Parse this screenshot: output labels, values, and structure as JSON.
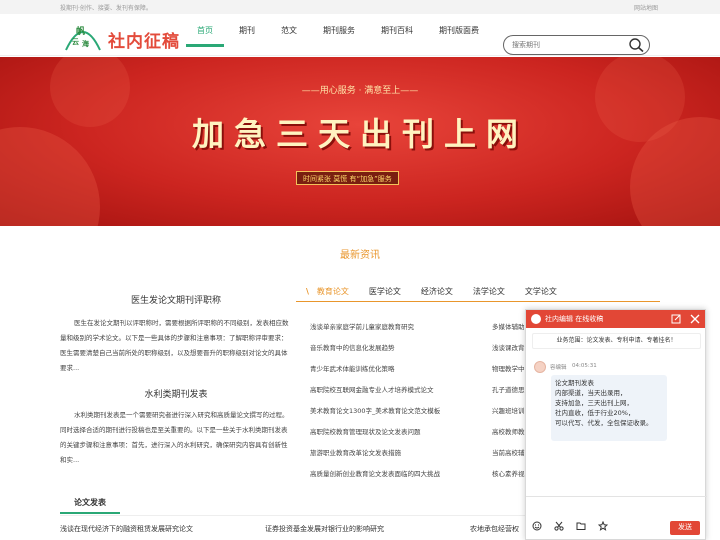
{
  "topbar": {
    "tagline": "投期刊·创作、接要、发刊有保障。",
    "sitemap": "网站地图"
  },
  "header": {
    "logo_text": "帆云海",
    "brand": "社内征稿",
    "nav": [
      "首页",
      "期刊",
      "范文",
      "期刊服务",
      "期刊百科",
      "期刊版面费"
    ],
    "search_placeholder": "搜索期刊"
  },
  "banner": {
    "tagline": "——用心服务 · 满意至上——",
    "title": "加急三天出刊上网",
    "slogan": "时间紧张 莫慌 有“加急”服务"
  },
  "news": {
    "section_title": "最新资讯",
    "article1_title": "医生发论文期刊评职称",
    "article1_text": "医生在发论文期刊以评职称时，需要根据所评职称的不同级别，发表相应数量和级别的学术论文。以下是一些具体的步骤和注意事项：了解职称评审要求：医生需要清楚自己当前所处的职称级别，以及想要晋升的职称级别对论文的具体要求...",
    "article2_title": "水利类期刊发表",
    "article2_text": "水利类期刊发表是一个需要研究者进行深入研究和高质量论文撰写的过程。同时选择合适的期刊进行投稿也是至关重要的。以下是一些关于水利类期刊发表的关键步骤和注意事项：首先，进行深入的水利研究，确保研究内容具有创新性和实...",
    "tabs": [
      "教育论文",
      "医学论文",
      "经济论文",
      "法学论文",
      "文学论文"
    ],
    "list_left": [
      "浅谈单亲家庭学前儿童家庭教育研究",
      "音乐教育中的信息化发展趋势",
      "青少年武术体能训练优化策略",
      "高职院校互联网金融专业人才培养模式论文",
      "美术教育论文1300字_美术教育论文范文模板",
      "高职院校教育管理现状及论文发表问题",
      "旅游职业教育改革论文发表措施",
      "高质量创新创业教育论文发表面临的四大挑战"
    ],
    "list_right": [
      "多媒体辅助",
      "浅谈课改背",
      "物理教学中",
      "孔子道德思",
      "兴趣班培训",
      "高校教师教",
      "当前高校辅",
      "核心素养视"
    ]
  },
  "footer": {
    "section_title": "论文发表",
    "papers": [
      "浅谈在现代经济下的融资租赁发展研究论文",
      "证券投资基金发展对银行业的影响研究",
      "农地承包经营权"
    ]
  },
  "chat": {
    "header_title": "社内编辑 在线收稿",
    "banner_text": "业务范围：论文发表、专利申请、专著挂名！",
    "agent_name": "容编辑",
    "agent_time": "04:05:31",
    "messages": [
      "论文期刊发表",
      "内部渠道，当天出录用，",
      "支持加急，三天出刊上网，",
      "社内直收，低于行业20%，",
      "可以代写、代发，全包保证收录。"
    ],
    "send_label": "发送"
  },
  "colors": {
    "accent": "#e24736",
    "green": "#2aa876",
    "orange": "#e9962c"
  }
}
